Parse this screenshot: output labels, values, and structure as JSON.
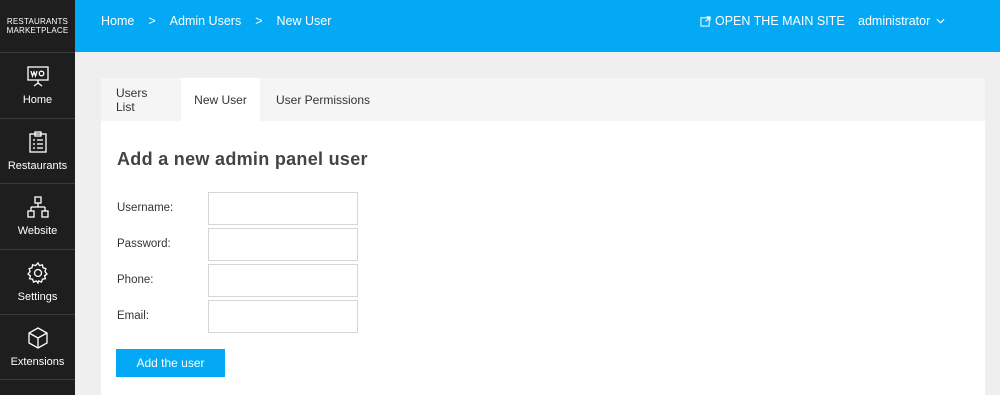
{
  "brand": {
    "line1": "RESTAURANTS",
    "line2": "MARKETPLACE"
  },
  "sidebar": {
    "items": [
      {
        "label": "Home",
        "icon": "presentation-board-icon"
      },
      {
        "label": "Restaurants",
        "icon": "clipboard-icon"
      },
      {
        "label": "Website",
        "icon": "sitemap-icon"
      },
      {
        "label": "Settings",
        "icon": "gear-icon"
      },
      {
        "label": "Extensions",
        "icon": "cube-icon"
      }
    ]
  },
  "topbar": {
    "breadcrumb": [
      "Home",
      "Admin Users",
      "New User"
    ],
    "separator": ">",
    "open_site_label": "OPEN THE MAIN SITE",
    "user_label": "administrator",
    "accent_color": "#03a9f4"
  },
  "tabs": [
    "Users List",
    "New User",
    "User Permissions"
  ],
  "active_tab": "New User",
  "form": {
    "title": "Add a new admin panel user",
    "fields": [
      {
        "label": "Username:",
        "value": ""
      },
      {
        "label": "Password:",
        "value": ""
      },
      {
        "label": "Phone:",
        "value": ""
      },
      {
        "label": "Email:",
        "value": ""
      }
    ],
    "submit_label": "Add the user"
  }
}
